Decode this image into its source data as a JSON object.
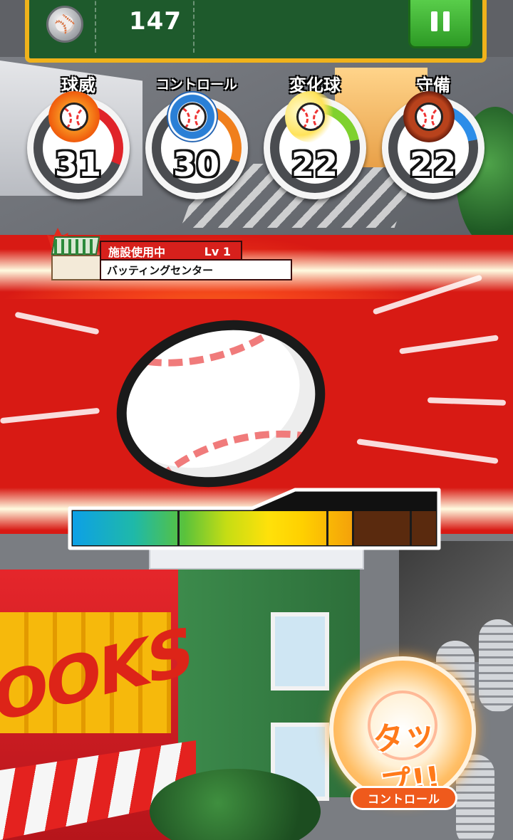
{
  "hud": {
    "coin_count": "147"
  },
  "stats": [
    {
      "label": "球威",
      "value": "31",
      "color": "#e0242a",
      "level": 0.31
    },
    {
      "label": "コントロール",
      "value": "30",
      "color": "#f07f1c",
      "level": 0.3
    },
    {
      "label": "変化球",
      "value": "22",
      "color": "#7fd12e",
      "level": 0.22
    },
    {
      "label": "守備",
      "value": "22",
      "color": "#2d8de8",
      "level": 0.22
    }
  ],
  "facility": {
    "status": "施設使用中",
    "level": "Lv 1",
    "name": "バッティングセンター"
  },
  "background": {
    "store_sign": "OOKS"
  },
  "meter": {
    "fill_fraction": 0.77,
    "marker_fractions": [
      0.29,
      0.7,
      0.77,
      0.93
    ]
  },
  "tap_button": {
    "text": "タップ!!",
    "label": "コントロール"
  },
  "colors": {
    "hud_green": "#1e5a2c",
    "hud_border": "#f0b21b",
    "accent_orange": "#ef5a1c"
  }
}
